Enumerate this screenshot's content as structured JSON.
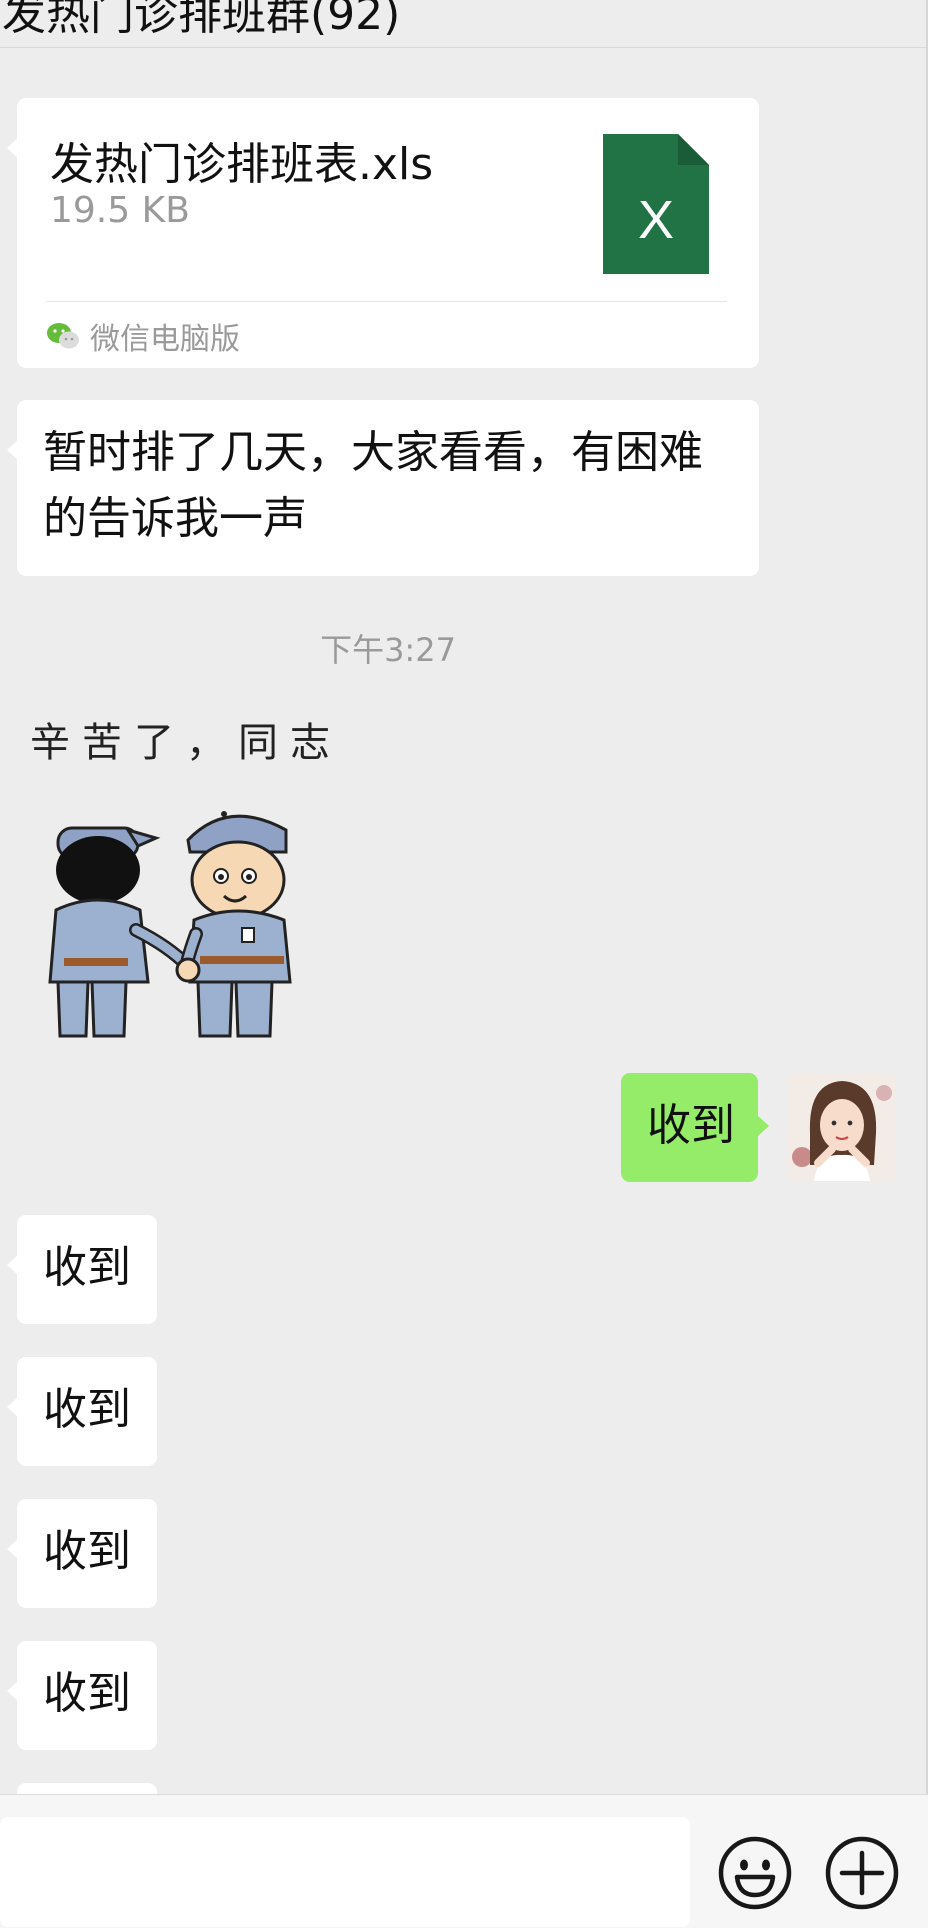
{
  "header": {
    "title": "发热门诊排班群(92)"
  },
  "messages": {
    "file_card": {
      "file_name": "发热门诊排班表.xls",
      "file_size": "19.5 KB",
      "file_icon_letter": "X",
      "source": "微信电脑版",
      "icon_color": "#217346"
    },
    "text_1": "暂时排了几天，大家看看，有困难的告诉我一声",
    "timestamp": "下午3:27",
    "sticker": {
      "text": "辛苦了，同志",
      "icon": "soldiers-handshake-sticker"
    },
    "self_reply": "收到",
    "received": [
      "收到",
      "收到",
      "收到",
      "收到"
    ]
  },
  "input_bar": {
    "value": "",
    "emoji_icon": "smiley-face-icon",
    "more_icon": "plus-circle-icon"
  },
  "colors": {
    "background": "#ededed",
    "self_bubble": "#95ec69",
    "other_bubble": "#ffffff"
  }
}
